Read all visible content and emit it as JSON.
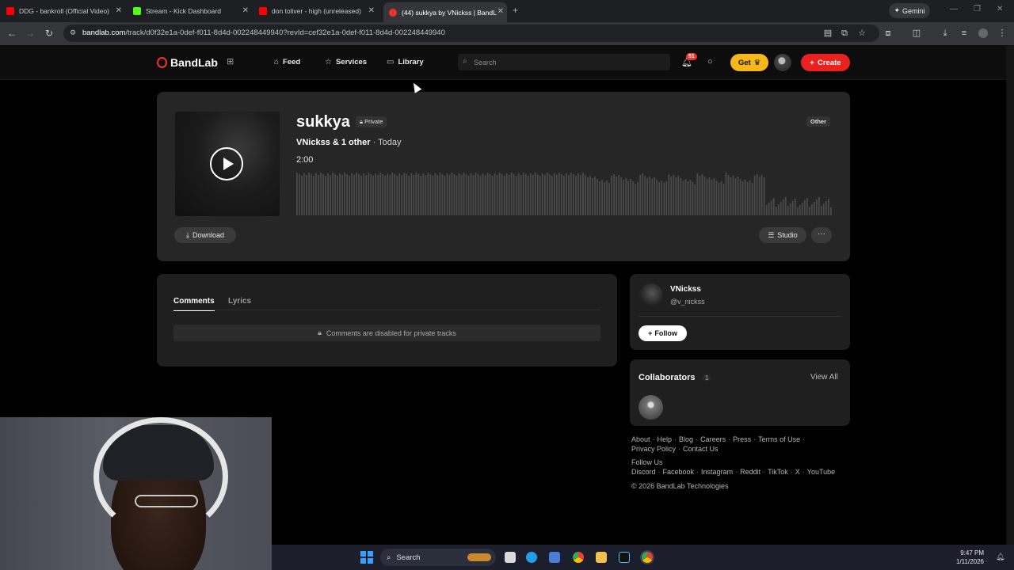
{
  "browser": {
    "tabs": [
      {
        "title": "DDG - bankroll (Official Video)",
        "icon": "youtube-icon",
        "color": "#ff0000"
      },
      {
        "title": "Stream - Kick Dashboard",
        "icon": "kick-icon",
        "color": "#53fc18"
      },
      {
        "title": "don toliver - high (unreleased)",
        "icon": "youtube-icon",
        "color": "#ff0000"
      },
      {
        "title": "(44) sukkya by VNickss | BandL",
        "icon": "bandlab-icon",
        "color": "#f2302d"
      }
    ],
    "gemini_label": "Gemini",
    "url_host": "bandlab.com",
    "url_path": "/track/d0f32e1a-0def-f011-8d4d-002248449940?revId=cef32e1a-0def-f011-8d4d-002248449940"
  },
  "header": {
    "logo_text": "BandLab",
    "nav": [
      {
        "label": "Feed",
        "icon": "home-icon"
      },
      {
        "label": "Services",
        "icon": "star-icon"
      },
      {
        "label": "Library",
        "icon": "library-icon"
      }
    ],
    "search_placeholder": "Search",
    "notification_count": "51",
    "get_label": "Get",
    "create_label": "Create",
    "accent": "#e8231f",
    "get_color": "#f6b71e"
  },
  "track": {
    "title": "sukkya",
    "privacy": "Private",
    "artists": "VNickss & 1 other",
    "date": "· Today",
    "duration": "2:00",
    "genre": "Other",
    "download_label": "Download",
    "studio_label": "Studio",
    "more_label": "···"
  },
  "comments": {
    "tabs": [
      "Comments",
      "Lyrics"
    ],
    "disabled_message": "Comments are disabled for private tracks"
  },
  "artist": {
    "name": "VNickss",
    "handle": "@v_nickss",
    "follow_label": "Follow"
  },
  "collaborators": {
    "title": "Collaborators",
    "count": "1",
    "view_all": "View All"
  },
  "footer": {
    "links_row1": [
      "About",
      "Help",
      "Blog",
      "Careers",
      "Press",
      "Terms of Use"
    ],
    "links_row2": [
      "Privacy Policy",
      "Contact Us"
    ],
    "follow_us": "Follow Us",
    "social": [
      "Discord",
      "Facebook",
      "Instagram",
      "Reddit",
      "TikTok",
      "X",
      "YouTube"
    ],
    "copyright": "© 2026 BandLab Technologies"
  },
  "taskbar": {
    "search_label": "Search",
    "time": "9:47 PM",
    "date": "1/11/2026"
  }
}
